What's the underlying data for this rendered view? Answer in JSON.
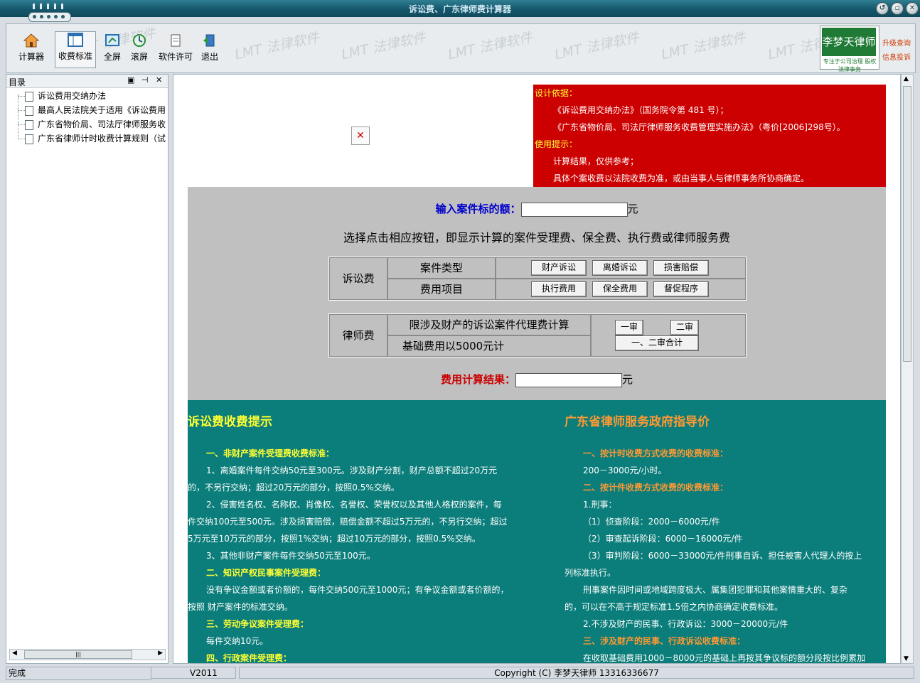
{
  "window": {
    "title": "诉讼费、广东律师费计算器",
    "controls": [
      "restore",
      "minimize",
      "close"
    ]
  },
  "toolbar": {
    "watermark": "LMT 法律软件",
    "buttons": [
      {
        "label": "计算器",
        "icon": "home-icon"
      },
      {
        "label": "收费标准",
        "icon": "window-layout-icon"
      },
      {
        "label": "全屏",
        "icon": "fullscreen-icon"
      },
      {
        "label": "滚屏",
        "icon": "refresh-icon"
      },
      {
        "label": "软件许可",
        "icon": "license-icon"
      },
      {
        "label": "退出",
        "icon": "exit-icon"
      }
    ],
    "selected": "收费标准",
    "brand_name": "李梦天律师",
    "brand_sub": "专注于公司治理 股权法律事务",
    "brand_side": [
      "升级查询",
      "信息投诉"
    ]
  },
  "sidebar": {
    "title": "目录",
    "items": [
      "诉讼费用交纳办法",
      "最高人民法院关于适用《诉讼费用",
      "广东省物价局、司法厅律师服务收",
      "广东省律师计时收费计算规则（试"
    ],
    "hscroll_glyph": "|||"
  },
  "notice": {
    "basis_title": "设计依据：",
    "basis_lines": [
      "《诉讼费用交纳办法》（国务院令第 481 号）；",
      "《广东省物价局、司法厅律师服务收费管理实施办法》（粤价[2006]298号）。"
    ],
    "tips_title": "使用提示：",
    "tips_lines": [
      "计算结果，仅供参考；",
      "具体个案收费以法院收费为准，或由当事人与律师事务所协商确定。"
    ]
  },
  "calculator": {
    "input_label": "输入案件标的额：",
    "unit": "元",
    "instruction": "选择点击相应按钮，即显示计算的案件受理费、保全费、执行费或律师服务费",
    "litigation": {
      "group": "诉讼费",
      "row1_label": "案件类型",
      "row1_buttons": [
        "财产诉讼",
        "离婚诉讼",
        "损害赔偿"
      ],
      "row2_label": "费用项目",
      "row2_buttons": [
        "执行费用",
        "保全费用",
        "督促程序"
      ]
    },
    "lawyer": {
      "group": "律师费",
      "row1_label": "限涉及财产的诉讼案件代理费计算",
      "row2_label": "基础费用以5000元计",
      "btn_first": "一审",
      "btn_second": "二审",
      "btn_total": "一、二审合计"
    },
    "result_label": "费用计算结果：",
    "input_value": "",
    "result_value": ""
  },
  "left_info": {
    "title": "诉讼费收费提示",
    "lines": [
      {
        "t": "一、非财产案件受理费收费标准：",
        "s": "y",
        "i": 1
      },
      {
        "t": "1、离婚案件每件交纳50元至300元。涉及财产分割，财产总额不超过20万元",
        "s": "n",
        "i": 1
      },
      {
        "t": "的，不另行交纳；超过20万元的部分，按照0.5%交纳。",
        "s": "n",
        "i": 0
      },
      {
        "t": "2、侵害姓名权、名称权、肖像权、名誉权、荣誉权以及其他人格权的案件，每",
        "s": "n",
        "i": 1
      },
      {
        "t": "件交纳100元至500元。涉及损害赔偿，赔偿金额不超过5万元的，不另行交纳；超过",
        "s": "n",
        "i": 0
      },
      {
        "t": "5万元至10万元的部分，按照1%交纳；超过10万元的部分，按照0.5%交纳。",
        "s": "n",
        "i": 0
      },
      {
        "t": "3、其他非财产案件每件交纳50元至100元。",
        "s": "n",
        "i": 1
      },
      {
        "t": "二、知识产权民事案件受理费：",
        "s": "y",
        "i": 1
      },
      {
        "t": "没有争议金额或者价额的，每件交纳500元至1000元；有争议金额或者价额的，",
        "s": "n",
        "i": 1
      },
      {
        "t": "按照  财产案件的标准交纳。",
        "s": "n",
        "i": 0
      },
      {
        "t": "三、劳动争议案件受理费：",
        "s": "y",
        "i": 1
      },
      {
        "t": "每件交纳10元。",
        "s": "n",
        "i": 1
      },
      {
        "t": "四、行政案件受理费：",
        "s": "y",
        "i": 1
      }
    ]
  },
  "right_info": {
    "title": "广东省律师服务政府指导价",
    "lines": [
      {
        "t": "一、按计时收费方式收费的收费标准：",
        "s": "o",
        "i": 1
      },
      {
        "t": "200－3000元/小时。",
        "s": "n",
        "i": 1
      },
      {
        "t": "二、按计件收费方式收费的收费标准：",
        "s": "o",
        "i": 1
      },
      {
        "t": "1.刑事：",
        "s": "n",
        "i": 1
      },
      {
        "t": "（1）侦查阶段：2000－6000元/件",
        "s": "n",
        "i": 1
      },
      {
        "t": "（2）审查起诉阶段：6000－16000元/件",
        "s": "n",
        "i": 1
      },
      {
        "t": "（3）审判阶段：6000－33000元/件刑事自诉、担任被害人代理人的按上",
        "s": "n",
        "i": 1
      },
      {
        "t": "列标准执行。",
        "s": "n",
        "i": 0
      },
      {
        "t": "刑事案件因时间或地域跨度极大、属集团犯罪和其他案情重大的、复杂",
        "s": "n",
        "i": 1
      },
      {
        "t": "的，可以在不高于规定标准1.5倍之内协商确定收费标准。",
        "s": "n",
        "i": 0
      },
      {
        "t": "2.不涉及财产的民事、行政诉讼：3000－20000元/件",
        "s": "n",
        "i": 1
      },
      {
        "t": "三、涉及财产的民事、行政诉讼收费标准：",
        "s": "o",
        "i": 1
      },
      {
        "t": "在收取基础费用1000－8000元的基础上再按其争议标的额分段按比例累加",
        "s": "n",
        "i": 1
      }
    ]
  },
  "statusbar": {
    "state": "完成",
    "version": "V2011",
    "copyright": "Copyright (C) 李梦天律师 13316336677"
  },
  "colors": {
    "notice_bg": "#cc0000",
    "info_bg": "#0b7d7a",
    "calc_bg": "#c0c0c0",
    "input_label": "#0000cc",
    "result_label": "#cc0000"
  }
}
